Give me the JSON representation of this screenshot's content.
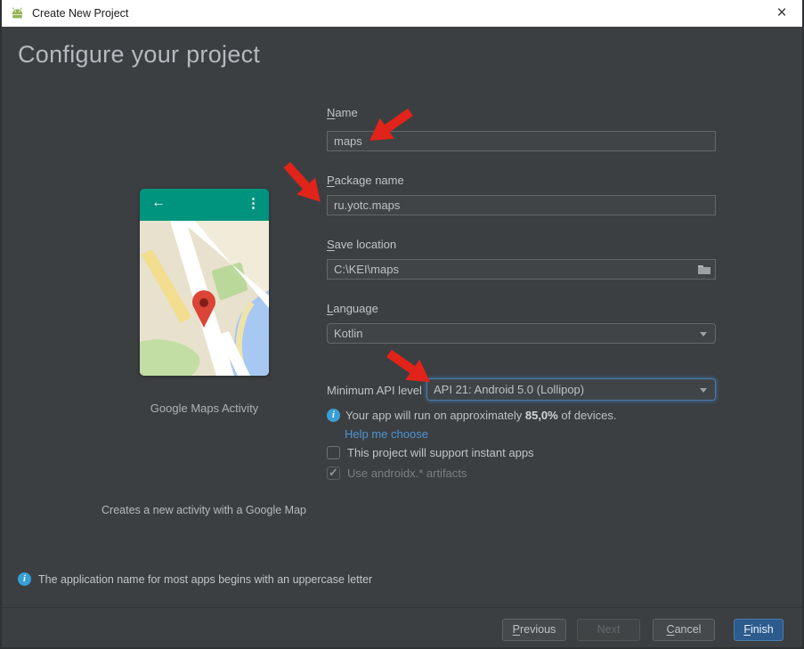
{
  "titlebar": {
    "title": "Create New Project"
  },
  "icons": {
    "close": "×",
    "back_arrow": "←",
    "overflow": "⋮",
    "info": "i",
    "checkmark": "✓"
  },
  "header": {
    "title": "Configure your project"
  },
  "preview": {
    "activity_name": "Google Maps Activity",
    "description": "Creates a new activity with a Google Map"
  },
  "form": {
    "name": {
      "mn": "N",
      "rest": "ame",
      "value": "maps"
    },
    "package": {
      "mn": "P",
      "rest": "ackage name",
      "value": "ru.yotc.maps"
    },
    "save": {
      "mn": "S",
      "rest": "ave location",
      "value": "C:\\KEI\\maps"
    },
    "language": {
      "mn": "L",
      "rest": "anguage",
      "value": "Kotlin"
    },
    "min_api": {
      "label": "Minimum API level",
      "value": "API 21: Android 5.0 (Lollipop)"
    },
    "device_info": {
      "prefix": "Your app will run on approximately ",
      "pct": "85,0%",
      "suffix": " of devices."
    },
    "help_link": "Help me choose",
    "checkboxes": [
      {
        "label": "This project will support instant apps",
        "checked": false
      },
      {
        "label": "Use androidx.* artifacts",
        "checked": true,
        "disabled": true
      }
    ]
  },
  "footer": {
    "note": "The application name for most apps begins with an uppercase letter",
    "previous": {
      "mn": "P",
      "rest": "revious"
    },
    "next": {
      "label": "Next"
    },
    "cancel": {
      "mn": "C",
      "rest": "ancel"
    },
    "finish": {
      "mn": "F",
      "rest": "inish"
    }
  },
  "colors": {
    "panel_bg": "#3c3f41",
    "accent_focus": "#4a7cac",
    "link": "#4b94d6",
    "annotation_red": "#e2231a",
    "appbar_teal": "#00947f",
    "finish_blue": "#2d5b8e",
    "info_blue": "#389fd6"
  }
}
